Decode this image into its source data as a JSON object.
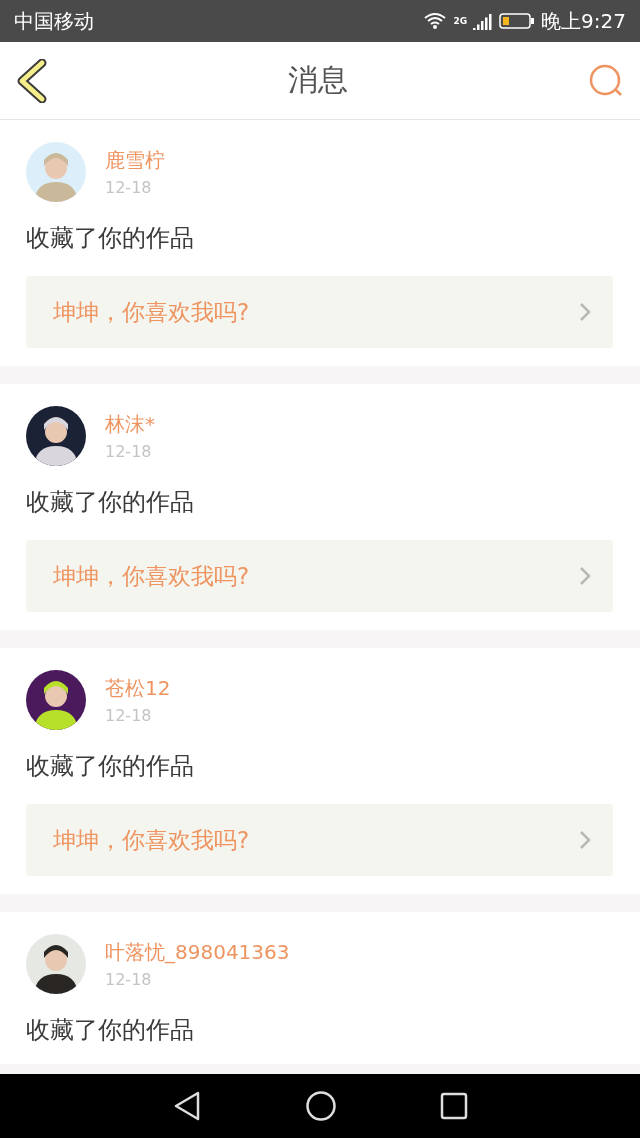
{
  "status_bar": {
    "carrier": "中国移动",
    "network": "2G",
    "time": "晚上9:27"
  },
  "header": {
    "title": "消息"
  },
  "messages": [
    {
      "name": "鹿雪柠",
      "date": "12-18",
      "action": "收藏了你的作品",
      "quote": "坤坤，你喜欢我吗?"
    },
    {
      "name": "林沫*",
      "date": "12-18",
      "action": "收藏了你的作品",
      "quote": "坤坤，你喜欢我吗?"
    },
    {
      "name": "苍松12",
      "date": "12-18",
      "action": "收藏了你的作品",
      "quote": "坤坤，你喜欢我吗?"
    },
    {
      "name": "叶落忧_898041363",
      "date": "12-18",
      "action": "收藏了你的作品"
    }
  ]
}
